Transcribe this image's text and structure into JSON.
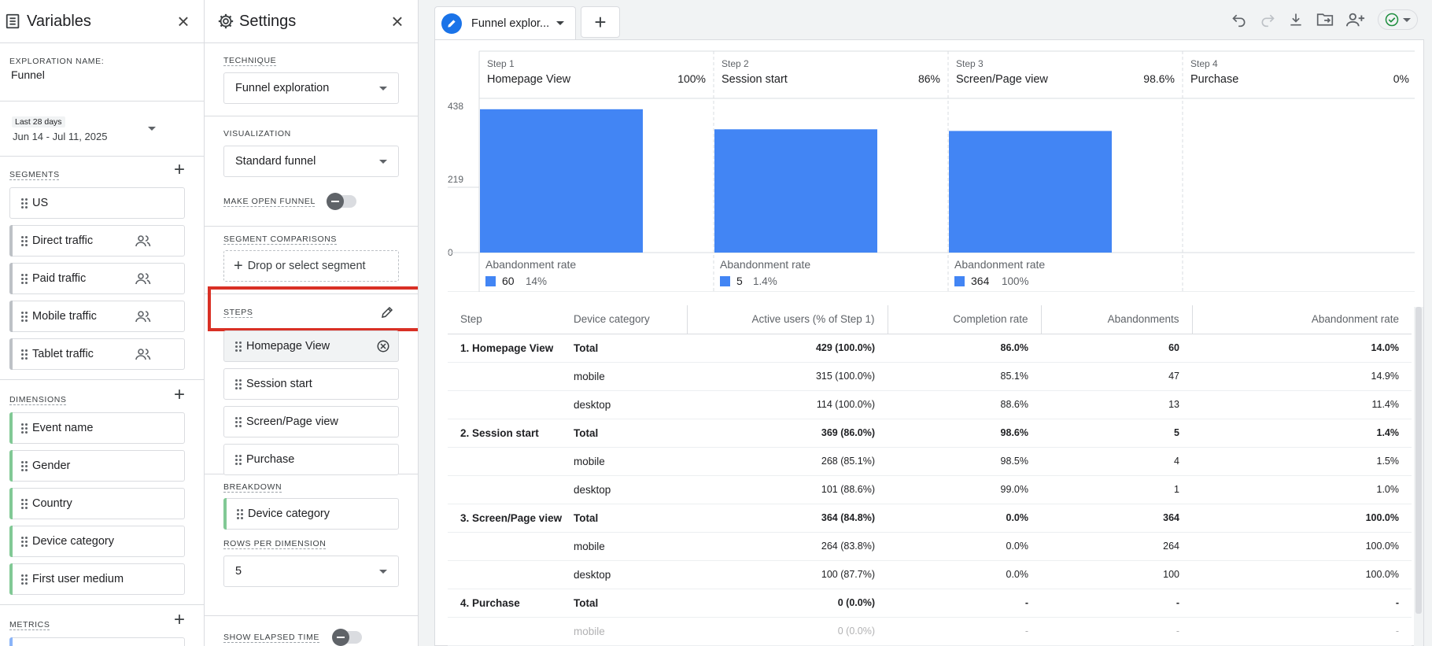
{
  "variables": {
    "title": "Variables",
    "exploration_name_label": "EXPLORATION NAME:",
    "exploration_name": "Funnel",
    "date_label": "Last 28 days",
    "date_range": "Jun 14 - Jul 11, 2025",
    "segments_label": "SEGMENTS",
    "segments": [
      "US",
      "Direct traffic",
      "Paid traffic",
      "Mobile traffic",
      "Tablet traffic"
    ],
    "dimensions_label": "DIMENSIONS",
    "dimensions": [
      "Event name",
      "Gender",
      "Country",
      "Device category",
      "First user medium"
    ],
    "metrics_label": "METRICS"
  },
  "settings": {
    "title": "Settings",
    "technique_label": "TECHNIQUE",
    "technique": "Funnel exploration",
    "visualization_label": "VISUALIZATION",
    "visualization": "Standard funnel",
    "open_funnel_label": "MAKE OPEN FUNNEL",
    "segment_comparisons_label": "SEGMENT COMPARISONS",
    "drop_segment": "Drop or select segment",
    "steps_label": "STEPS",
    "steps": [
      "Homepage View",
      "Session start",
      "Screen/Page view",
      "Purchase"
    ],
    "breakdown_label": "BREAKDOWN",
    "breakdown": "Device category",
    "rows_label": "ROWS PER DIMENSION",
    "rows_value": "5",
    "elapsed_label": "SHOW ELAPSED TIME"
  },
  "tab": {
    "label": "Funnel explor..."
  },
  "chart_data": {
    "type": "bar",
    "ylim": [
      0,
      438
    ],
    "yticks": [
      "438",
      "219",
      "0"
    ],
    "steps": [
      {
        "step": "Step 1",
        "name": "Homepage View",
        "pct": "100%",
        "value": 429,
        "abandon_label": "Abandonment rate",
        "abandon_count": "60",
        "abandon_rate": "14%"
      },
      {
        "step": "Step 2",
        "name": "Session start",
        "pct": "86%",
        "value": 369,
        "abandon_label": "Abandonment rate",
        "abandon_count": "5",
        "abandon_rate": "1.4%"
      },
      {
        "step": "Step 3",
        "name": "Screen/Page view",
        "pct": "98.6%",
        "value": 364,
        "abandon_label": "Abandonment rate",
        "abandon_count": "364",
        "abandon_rate": "100%"
      },
      {
        "step": "Step 4",
        "name": "Purchase",
        "pct": "0%",
        "value": 0
      }
    ],
    "bar_color": "#4285f4"
  },
  "table": {
    "headers": [
      "Step",
      "Device category",
      "Active users (% of Step 1)",
      "Completion rate",
      "Abandonments",
      "Abandonment rate"
    ],
    "rows": [
      {
        "step": "1. Homepage View",
        "device": "Total",
        "users": "429 (100.0%)",
        "completion": "86.0%",
        "aband": "60",
        "rate": "14.0%",
        "total": true
      },
      {
        "step": "",
        "device": "mobile",
        "users": "315 (100.0%)",
        "completion": "85.1%",
        "aband": "47",
        "rate": "14.9%"
      },
      {
        "step": "",
        "device": "desktop",
        "users": "114 (100.0%)",
        "completion": "88.6%",
        "aband": "13",
        "rate": "11.4%"
      },
      {
        "step": "2. Session start",
        "device": "Total",
        "users": "369 (86.0%)",
        "completion": "98.6%",
        "aband": "5",
        "rate": "1.4%",
        "total": true
      },
      {
        "step": "",
        "device": "mobile",
        "users": "268 (85.1%)",
        "completion": "98.5%",
        "aband": "4",
        "rate": "1.5%"
      },
      {
        "step": "",
        "device": "desktop",
        "users": "101 (88.6%)",
        "completion": "99.0%",
        "aband": "1",
        "rate": "1.0%"
      },
      {
        "step": "3. Screen/Page view",
        "device": "Total",
        "users": "364 (84.8%)",
        "completion": "0.0%",
        "aband": "364",
        "rate": "100.0%",
        "total": true
      },
      {
        "step": "",
        "device": "mobile",
        "users": "264 (83.8%)",
        "completion": "0.0%",
        "aband": "264",
        "rate": "100.0%"
      },
      {
        "step": "",
        "device": "desktop",
        "users": "100 (87.7%)",
        "completion": "0.0%",
        "aband": "100",
        "rate": "100.0%"
      },
      {
        "step": "4. Purchase",
        "device": "Total",
        "users": "0 (0.0%)",
        "completion": "-",
        "aband": "-",
        "rate": "-",
        "total": true
      },
      {
        "step": "",
        "device": "mobile",
        "users": "0 (0.0%)",
        "completion": "-",
        "aband": "-",
        "rate": "-",
        "faded": true
      }
    ]
  },
  "colors": {
    "accent": "#1a73e8",
    "highlight_box": "#d93025",
    "bar": "#4285f4"
  }
}
